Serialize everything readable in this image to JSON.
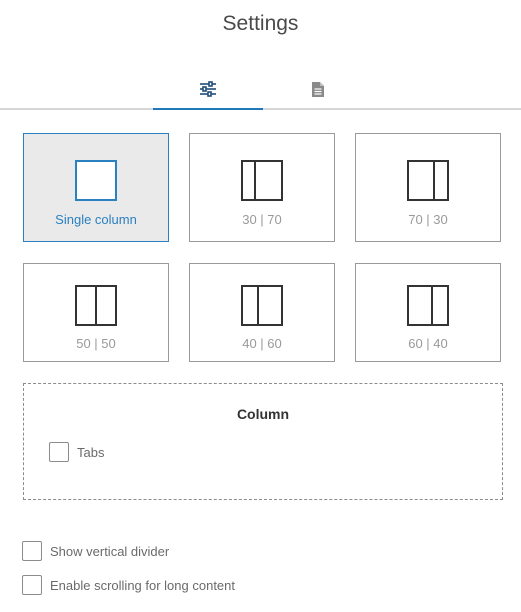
{
  "header": {
    "title": "Settings"
  },
  "tabs": [
    {
      "name": "layout",
      "icon": "sliders-icon",
      "active": true
    },
    {
      "name": "content",
      "icon": "document-icon",
      "active": false
    }
  ],
  "layouts": [
    {
      "label": "Single column",
      "selected": true
    },
    {
      "label": "30 | 70",
      "selected": false
    },
    {
      "label": "70 | 30",
      "selected": false
    },
    {
      "label": "50 | 50",
      "selected": false
    },
    {
      "label": "40 | 60",
      "selected": false
    },
    {
      "label": "60 | 40",
      "selected": false
    }
  ],
  "column_section": {
    "title": "Column",
    "tabs_label": "Tabs",
    "tabs_checked": false
  },
  "options": {
    "vertical_divider_label": "Show vertical divider",
    "vertical_divider_checked": false,
    "scrolling_label": "Enable scrolling for long content",
    "scrolling_checked": false
  },
  "colors": {
    "accent": "#1f79b8",
    "selected_bg": "#eaeaea",
    "border": "#9a9a9a"
  }
}
